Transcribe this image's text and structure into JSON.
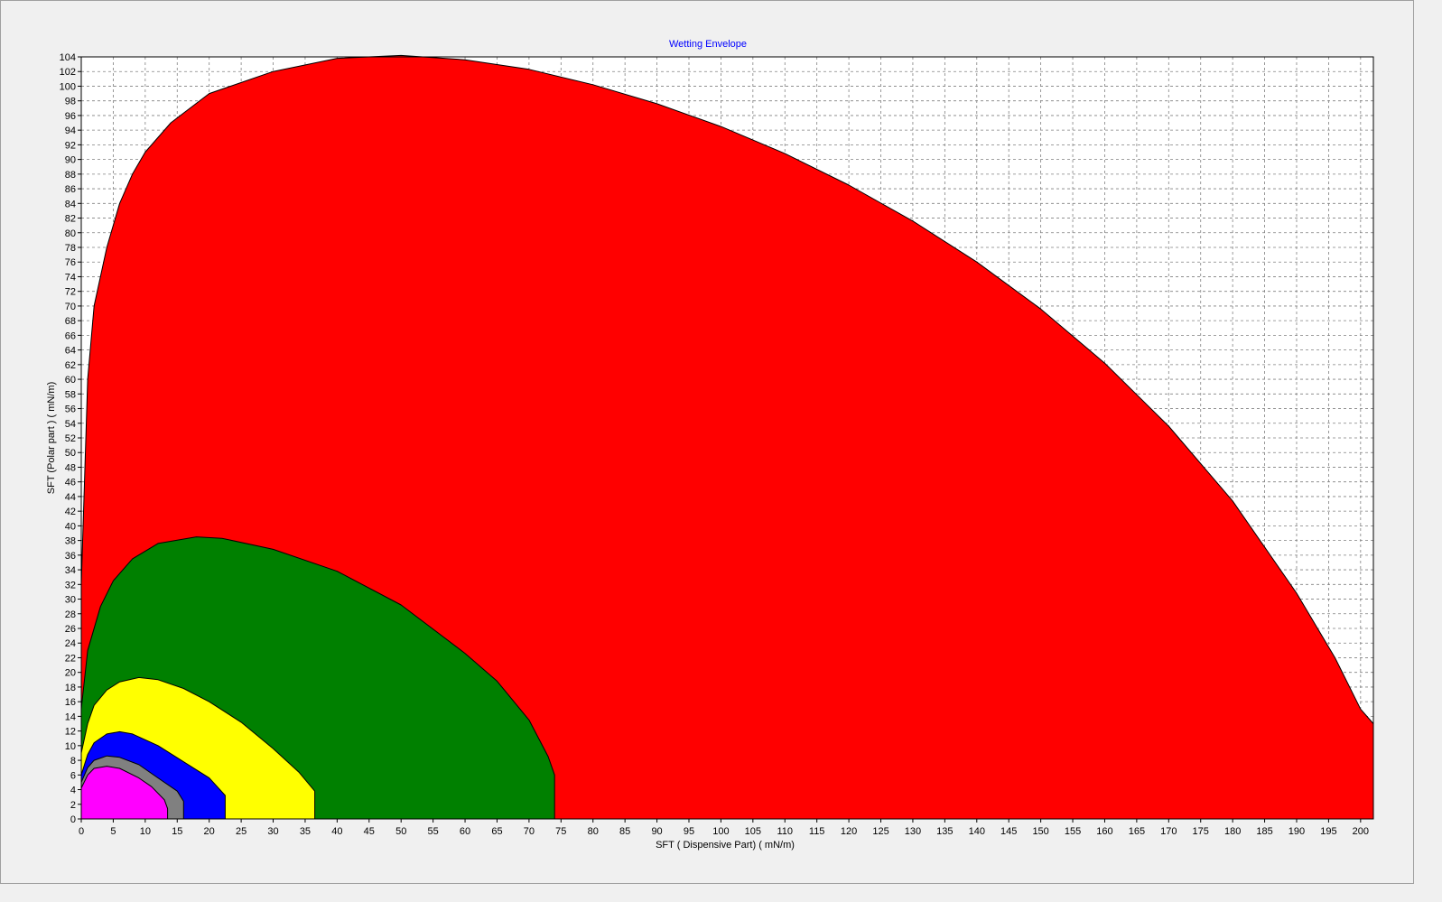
{
  "chart_data": {
    "type": "area",
    "title": "Wetting Envelope",
    "xlabel": "SFT ( Dispensive Part)  ( mN/m)",
    "ylabel": "SFT  (Polar part )  ( mN/m)",
    "xlim": [
      0,
      202
    ],
    "ylim": [
      0,
      104
    ],
    "x_tick_step": 5,
    "y_tick_step": 2,
    "grid": true,
    "colors": {
      "title": "#0000ff",
      "grid": "#808080",
      "plot_background": "#ffffff",
      "outline": "#000000"
    },
    "series": [
      {
        "color": "#ff0000",
        "values": [
          [
            0,
            32
          ],
          [
            1,
            60
          ],
          [
            2,
            70
          ],
          [
            4,
            78
          ],
          [
            6,
            84
          ],
          [
            8,
            88
          ],
          [
            10,
            91
          ],
          [
            14,
            95
          ],
          [
            20,
            99
          ],
          [
            30,
            102
          ],
          [
            40,
            103.8
          ],
          [
            50,
            104.2
          ],
          [
            60,
            103.6
          ],
          [
            70,
            102.3
          ],
          [
            80,
            100.2
          ],
          [
            90,
            97.6
          ],
          [
            100,
            94.5
          ],
          [
            110,
            90.8
          ],
          [
            120,
            86.5
          ],
          [
            130,
            81.6
          ],
          [
            140,
            76
          ],
          [
            150,
            69.6
          ],
          [
            160,
            62.2
          ],
          [
            170,
            53.6
          ],
          [
            180,
            43.4
          ],
          [
            190,
            30.8
          ],
          [
            196,
            22
          ],
          [
            200,
            15
          ],
          [
            202,
            13
          ],
          [
            202,
            0
          ],
          [
            0,
            0
          ]
        ]
      },
      {
        "color": "#008000",
        "values": [
          [
            0,
            15
          ],
          [
            1,
            23
          ],
          [
            3,
            29
          ],
          [
            5,
            32.5
          ],
          [
            8,
            35.5
          ],
          [
            12,
            37.6
          ],
          [
            18,
            38.5
          ],
          [
            22,
            38.3
          ],
          [
            30,
            36.8
          ],
          [
            40,
            33.8
          ],
          [
            50,
            29.2
          ],
          [
            60,
            22.6
          ],
          [
            65,
            18.8
          ],
          [
            70,
            13.5
          ],
          [
            73,
            8.5
          ],
          [
            74,
            6
          ],
          [
            74,
            0
          ],
          [
            0,
            0
          ]
        ]
      },
      {
        "color": "#ffff00",
        "values": [
          [
            0,
            9
          ],
          [
            1,
            13
          ],
          [
            2,
            15.5
          ],
          [
            4,
            17.6
          ],
          [
            6,
            18.7
          ],
          [
            9,
            19.3
          ],
          [
            12,
            19
          ],
          [
            16,
            17.8
          ],
          [
            20,
            16
          ],
          [
            25,
            13.2
          ],
          [
            30,
            9.6
          ],
          [
            34,
            6.4
          ],
          [
            36.5,
            3.8
          ],
          [
            36.5,
            0
          ],
          [
            0,
            0
          ]
        ]
      },
      {
        "color": "#0000ff",
        "values": [
          [
            0,
            6
          ],
          [
            1,
            8.8
          ],
          [
            2,
            10.4
          ],
          [
            4,
            11.6
          ],
          [
            6,
            11.9
          ],
          [
            8,
            11.6
          ],
          [
            12,
            10
          ],
          [
            16,
            7.8
          ],
          [
            20,
            5.6
          ],
          [
            22.5,
            3.2
          ],
          [
            22.5,
            0
          ],
          [
            0,
            0
          ]
        ]
      },
      {
        "color": "#808080",
        "values": [
          [
            0,
            5
          ],
          [
            1,
            7
          ],
          [
            2,
            8
          ],
          [
            4,
            8.6
          ],
          [
            6,
            8.4
          ],
          [
            9,
            7.4
          ],
          [
            12,
            5.6
          ],
          [
            15,
            3.8
          ],
          [
            16,
            2.4
          ],
          [
            16,
            0
          ],
          [
            0,
            0
          ]
        ]
      },
      {
        "color": "#ff00ff",
        "values": [
          [
            0,
            4.2
          ],
          [
            1,
            6
          ],
          [
            2,
            6.9
          ],
          [
            4,
            7.2
          ],
          [
            6,
            6.9
          ],
          [
            9,
            5.6
          ],
          [
            11,
            4.4
          ],
          [
            13,
            2.6
          ],
          [
            13.5,
            1.4
          ],
          [
            13.5,
            0
          ],
          [
            0,
            0
          ]
        ]
      }
    ]
  }
}
